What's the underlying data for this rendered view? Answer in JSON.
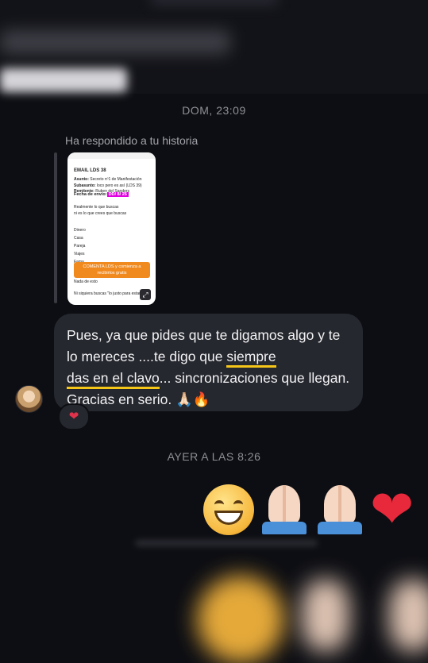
{
  "timestamps": {
    "first": "DOM, 23:09",
    "second": "AYER A LAS 8:26"
  },
  "story_reply": {
    "label": "Ha respondido a tu historia",
    "card": {
      "title": "EMAIL LDS 38",
      "asunto_label": "Asunto:",
      "asunto": "Secreto nº1 de Manifestación",
      "subasunto_label": "Subasunto:",
      "subasunto": "loco pero es así (LDS 39)",
      "remitente_label": "Remitente:",
      "remitente": "Ruben del Sanders",
      "fecha_label": "Fecha de envío:",
      "fecha": "DD/ 8/ 25",
      "p1": "Realmente lo que buscas",
      "p2": "ni es lo que crees que buscas",
      "list": [
        "Dinero",
        "Casa",
        "Pareja",
        "Viajes",
        "Fama"
      ],
      "cta": "COMENTA LDS y comienza a recibirlos gratis",
      "p3": "Nada de esto",
      "p4": "Ni siquiera buscas \"lo justo para estar bien\"",
      "expand_icon": "expand-icon"
    }
  },
  "message": {
    "pre": "Pues, ya que pides que te digamos algo y te lo mereces ....te digo que ",
    "hl1": "siempre",
    "hl2": "das en el clavo",
    "post": "... sincronizaciones que llegan. Gracias en serio. 🙏🏻🔥",
    "reaction": "❤",
    "highlight_color": "#f5c518"
  },
  "reply_emojis": [
    "grinning-face",
    "folded-hands",
    "folded-hands",
    "red-heart"
  ],
  "heart": "❤"
}
